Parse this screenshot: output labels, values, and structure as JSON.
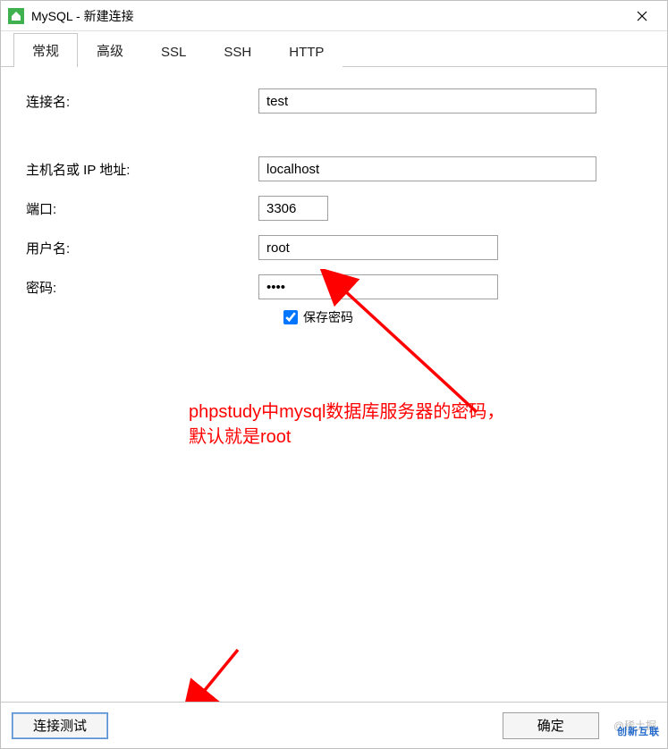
{
  "window": {
    "title": "MySQL - 新建连接"
  },
  "tabs": {
    "general": "常规",
    "advanced": "高级",
    "ssl": "SSL",
    "ssh": "SSH",
    "http": "HTTP"
  },
  "form": {
    "connection_name_label": "连接名:",
    "connection_name_value": "test",
    "host_label": "主机名或 IP 地址:",
    "host_value": "localhost",
    "port_label": "端口:",
    "port_value": "3306",
    "user_label": "用户名:",
    "user_value": "root",
    "password_label": "密码:",
    "password_value": "••••",
    "save_password_label": "保存密码"
  },
  "annotation": {
    "line1": "phpstudy中mysql数据库服务器的密码，",
    "line2": "默认就是root"
  },
  "footer": {
    "test_connection": "连接测试",
    "ok": "确定",
    "watermark": "@稀土掘"
  },
  "corner_brand": "创新互联"
}
